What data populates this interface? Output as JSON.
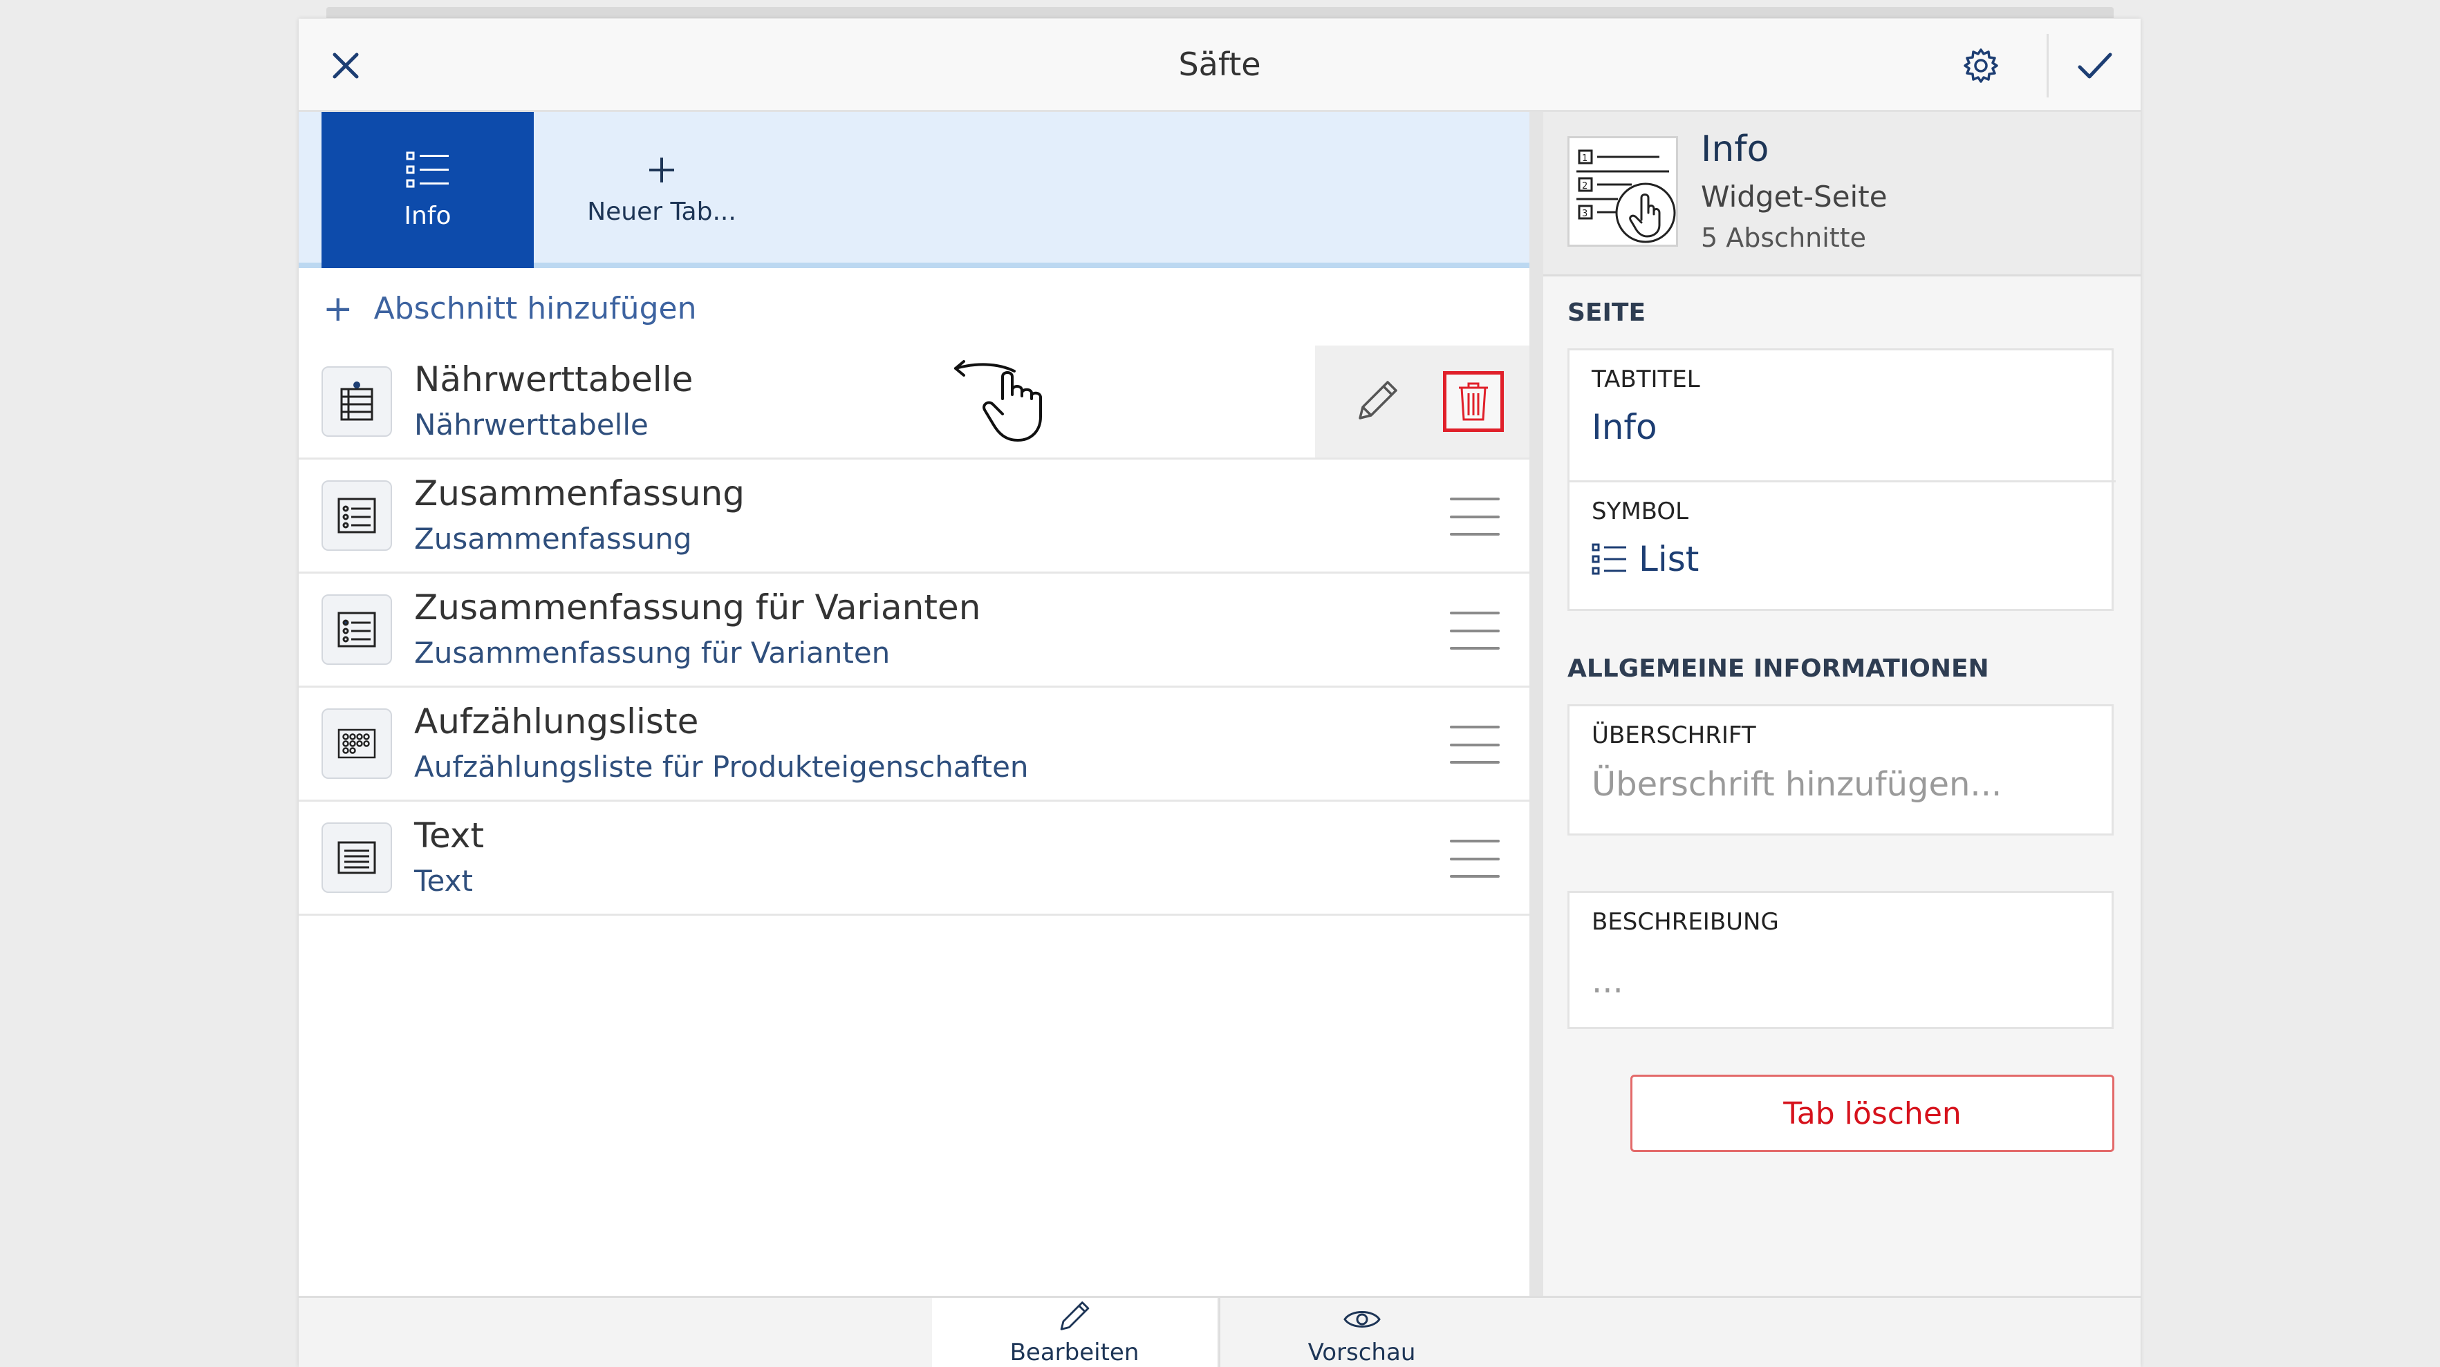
{
  "header": {
    "title": "Säfte",
    "close_icon": "close-icon",
    "settings_icon": "gear-icon",
    "confirm_icon": "check-icon"
  },
  "tabs": [
    {
      "label": "Info",
      "icon": "list-icon",
      "active": true
    },
    {
      "label": "Neuer Tab...",
      "icon": "plus-icon",
      "active": false
    }
  ],
  "add_section_label": "Abschnitt hinzufügen",
  "sections": [
    {
      "title": "Nährwerttabelle",
      "subtitle": "Nährwerttabelle",
      "icon": "table-icon",
      "swiped": true
    },
    {
      "title": "Zusammenfassung",
      "subtitle": "Zusammenfassung",
      "icon": "summary-icon",
      "swiped": false
    },
    {
      "title": "Zusammenfassung für Varianten",
      "subtitle": "Zusammenfassung für Varianten",
      "icon": "summary-icon",
      "swiped": false
    },
    {
      "title": "Aufzählungsliste",
      "subtitle": "Aufzählungsliste für Produkteigenschaften",
      "icon": "bullet-grid-icon",
      "swiped": false
    },
    {
      "title": "Text",
      "subtitle": "Text",
      "icon": "text-icon",
      "swiped": false
    }
  ],
  "info_panel": {
    "name": "Info",
    "type": "Widget-Seite",
    "count": "5 Abschnitte"
  },
  "page_section": {
    "heading": "SEITE",
    "tab_title_label": "TABTITEL",
    "tab_title_value": "Info",
    "symbol_label": "SYMBOL",
    "symbol_value": "List"
  },
  "general_section": {
    "heading": "ALLGEMEINE INFORMATIONEN",
    "headline_label": "ÜBERSCHRIFT",
    "headline_placeholder": "Überschrift hinzufügen...",
    "description_label": "BESCHREIBUNG",
    "description_placeholder": "..."
  },
  "delete_tab_label": "Tab löschen",
  "colors": {
    "accent": "#0d4bab",
    "danger": "#d6121c",
    "link": "#3d63a0"
  },
  "bottom_tabs": [
    {
      "label": "Bearbeiten",
      "icon": "pencil-icon",
      "active": true
    },
    {
      "label": "Vorschau",
      "icon": "eye-icon",
      "active": false
    }
  ]
}
